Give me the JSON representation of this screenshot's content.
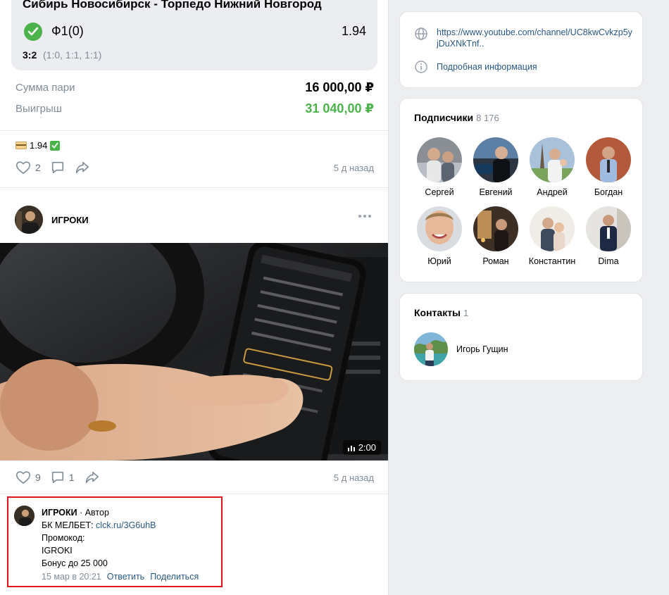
{
  "bet": {
    "match_title": "Сибирь Новосибирск - Торпедо Нижний Новгород",
    "outcome": "Ф1(0)",
    "odds": "1.94",
    "score": "3:2",
    "score_detail": "(1:0, 1:1, 1:1)",
    "stake_label": "Сумма пари",
    "stake_value": "16 000,00 ₽",
    "win_label": "Выигрыш",
    "win_value": "31 040,00 ₽"
  },
  "post1": {
    "text": "1.94",
    "likes": "2",
    "time_ago": "5 д назад"
  },
  "post2": {
    "author": "ИГРОКИ",
    "video_duration": "2:00",
    "likes": "9",
    "comments": "1",
    "time_ago": "5 д назад"
  },
  "comment": {
    "author": "ИГРОКИ",
    "role": " · Автор",
    "line1_prefix": "БК МЕЛБЕТ: ",
    "line1_link": "clck.ru/3G6uhB",
    "line2": "Промокод:",
    "line3": "IGROKI",
    "line4": "Бонус до 25 000",
    "date": "15 мар в 20:21",
    "reply": "Ответить",
    "share": "Поделиться"
  },
  "links_panel": {
    "website": "https://www.youtube.com/channel/UC8kwCvkzp5yjDuXNkTnf..",
    "info": "Подробная информация"
  },
  "subscribers": {
    "title": "Подписчики",
    "count": "8 176",
    "people": [
      {
        "name": "Сергей"
      },
      {
        "name": "Евгений"
      },
      {
        "name": "Андрей"
      },
      {
        "name": "Богдан"
      },
      {
        "name": "Юрий"
      },
      {
        "name": "Роман"
      },
      {
        "name": "Константин"
      },
      {
        "name": "Dima"
      }
    ]
  },
  "contacts": {
    "title": "Контакты",
    "count": "1",
    "person": "Игорь Гущин"
  },
  "colors": {
    "accent_link": "#2a5885",
    "success_green": "#4bb34b",
    "highlight_red": "#e0161c"
  }
}
